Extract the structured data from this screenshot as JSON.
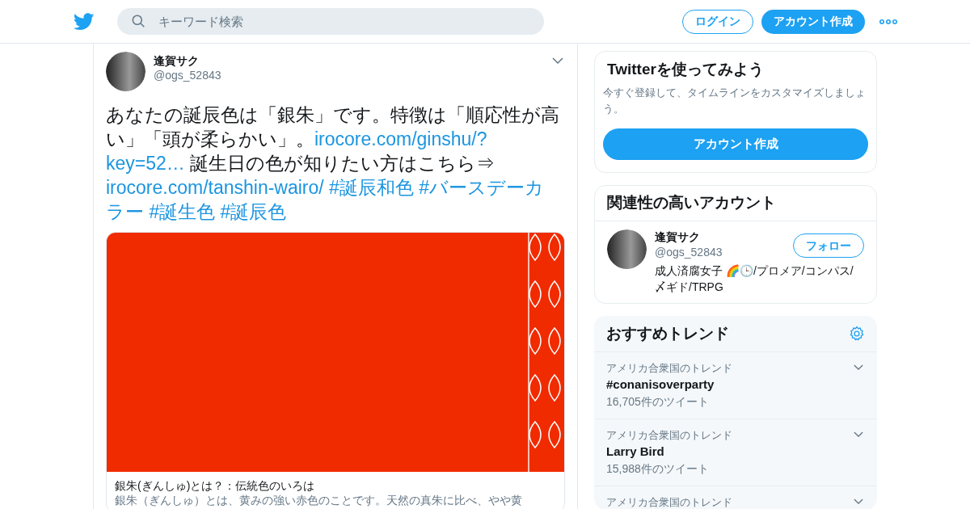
{
  "header": {
    "search": {
      "placeholder": "キーワード検索"
    },
    "login": "ログイン",
    "signup": "アカウント作成"
  },
  "tweet": {
    "name": "逢賀サク",
    "handle": "@ogs_52843",
    "lines": [
      [
        {
          "kind": "text",
          "text": "あなたの誕辰色は「銀朱」です。特徴は「順応性が高"
        }
      ],
      [
        {
          "kind": "text",
          "text": "い」「頭が柔らかい」。"
        },
        {
          "kind": "link",
          "text": "irocore.com/ginshu/?"
        }
      ],
      [
        {
          "kind": "link",
          "text": "key=52…"
        },
        {
          "kind": "text",
          "text": " 誕生日の色が知りたい方はこちら⇒"
        }
      ],
      [
        {
          "kind": "link",
          "text": "irocore.com/tanshin-wairo/"
        },
        {
          "kind": "link",
          "text": "#誕辰和色"
        },
        {
          "kind": "link",
          "text": "#バースデーカ"
        }
      ],
      [
        {
          "kind": "link",
          "text": "ラー"
        },
        {
          "kind": "link",
          "text": "#誕生色"
        },
        {
          "kind": "link",
          "text": "#誕辰色"
        }
      ]
    ],
    "card": {
      "title": "銀朱(ぎんしゅ)とは？：伝統色のいろは",
      "description": "銀朱（ぎんしゅ）とは、黄みの強い赤色のことです。天然の真朱に比べ、やや黄"
    }
  },
  "signup_panel": {
    "title": "Twitterを使ってみよう",
    "text": "今すぐ登録して、タイムラインをカスタマイズしましょう。",
    "button": "アカウント作成"
  },
  "related": {
    "title": "関連性の高いアカウント",
    "accounts": [
      {
        "name": "逢賀サク",
        "handle": "@ogs_52843",
        "follow": "フォロー",
        "bio": "成人済腐女子 🌈🕒/プロメア/コンパス/〆ギド/TRPG"
      }
    ]
  },
  "trends": {
    "title": "おすすめトレンド",
    "items": [
      {
        "context": "アメリカ合衆国のトレンド",
        "name": "#conanisoverparty",
        "count": "16,705件のツイート"
      },
      {
        "context": "アメリカ合衆国のトレンド",
        "name": "Larry Bird",
        "count": "15,988件のツイート"
      },
      {
        "context": "アメリカ合衆国のトレンド"
      }
    ]
  }
}
